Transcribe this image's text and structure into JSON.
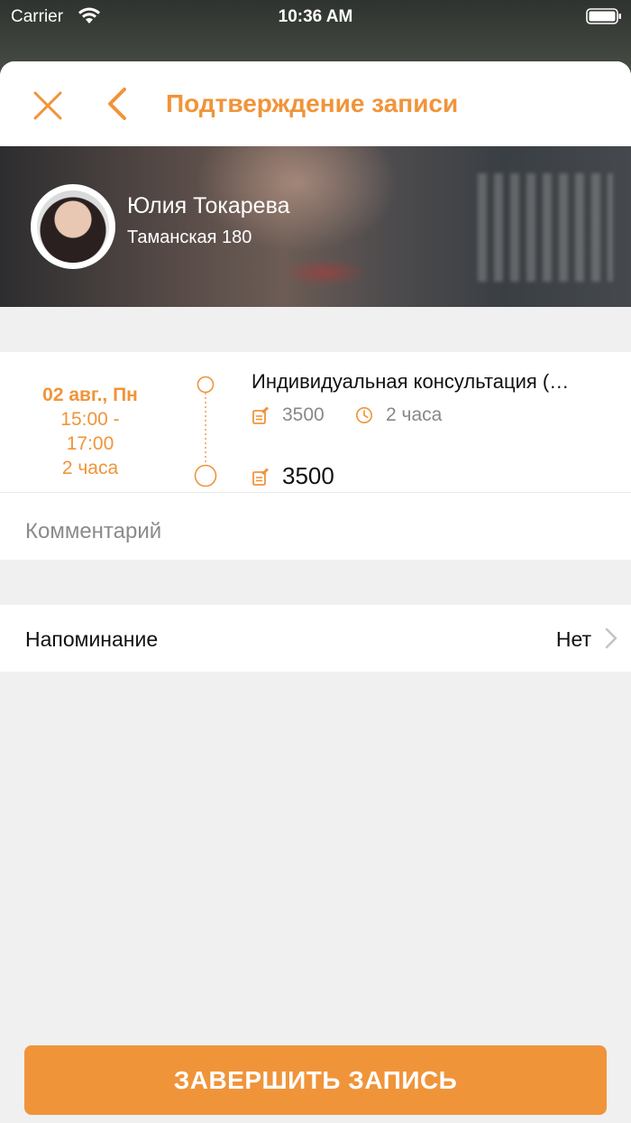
{
  "status_bar": {
    "carrier": "Carrier",
    "time": "10:36 AM"
  },
  "nav": {
    "title": "Подтверждение записи"
  },
  "specialist": {
    "name": "Юлия Токарева",
    "address": "Таманская 180"
  },
  "booking": {
    "date": "02 авг., Пн",
    "time_range_start": "15:00 -",
    "time_range_end": "17:00",
    "duration": "2 часа",
    "service_name": "Индивидуальная консультация (…",
    "service_price": "3500",
    "service_duration": "2 часа",
    "total_price": "3500"
  },
  "comment": {
    "placeholder": "Комментарий"
  },
  "reminder": {
    "label": "Напоминание",
    "value": "Нет"
  },
  "actions": {
    "finish_label": "ЗАВЕРШИТЬ ЗАПИСЬ"
  },
  "colors": {
    "accent": "#f0943a",
    "background": "#f0f0f0"
  },
  "icons": {
    "close": "close-icon",
    "back": "chevron-left-icon",
    "price": "price-tag-icon",
    "clock": "clock-icon",
    "chevron": "chevron-right-icon"
  }
}
